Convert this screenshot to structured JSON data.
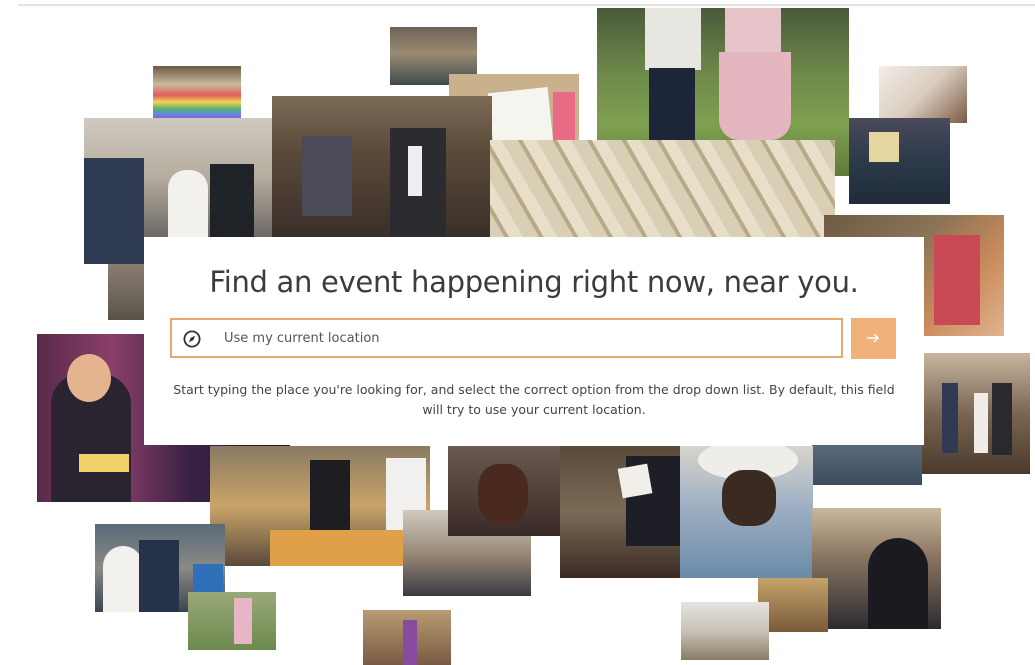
{
  "hero": {
    "heading": "Find an event happening right now, near you.",
    "search": {
      "placeholder": "Use my current location",
      "icon": "compass-icon"
    },
    "submit": {
      "icon": "arrow-right-icon"
    },
    "help_text": "Start typing the place you're looking for, and select the correct option from the drop down list. By default, this field will try to use your current location."
  },
  "colors": {
    "accent_border": "#e7a96a",
    "button": "#f0b27a",
    "heading": "#3c3c3c"
  },
  "collage_photos": [
    "photo-church-nave",
    "photo-children-holding-hands",
    "photo-rainbow-flag",
    "photo-congregation-standing",
    "photo-card-you-are-invited",
    "photo-lady-with-headscarf",
    "photo-wedding-couple",
    "photo-congregation-mingling",
    "photo-gothic-ceiling",
    "photo-bishop-with-children",
    "photo-child-with-balloons",
    "photo-young-worshipper",
    "photo-wedding-aisle",
    "photo-choir-singing",
    "photo-family-gathering",
    "photo-reading-hymn-book",
    "photo-lady-in-hat",
    "photo-cathedral-interior",
    "photo-wedding-kiss",
    "photo-bride-and-child",
    "photo-clergy-group",
    "photo-congregation-pews"
  ]
}
